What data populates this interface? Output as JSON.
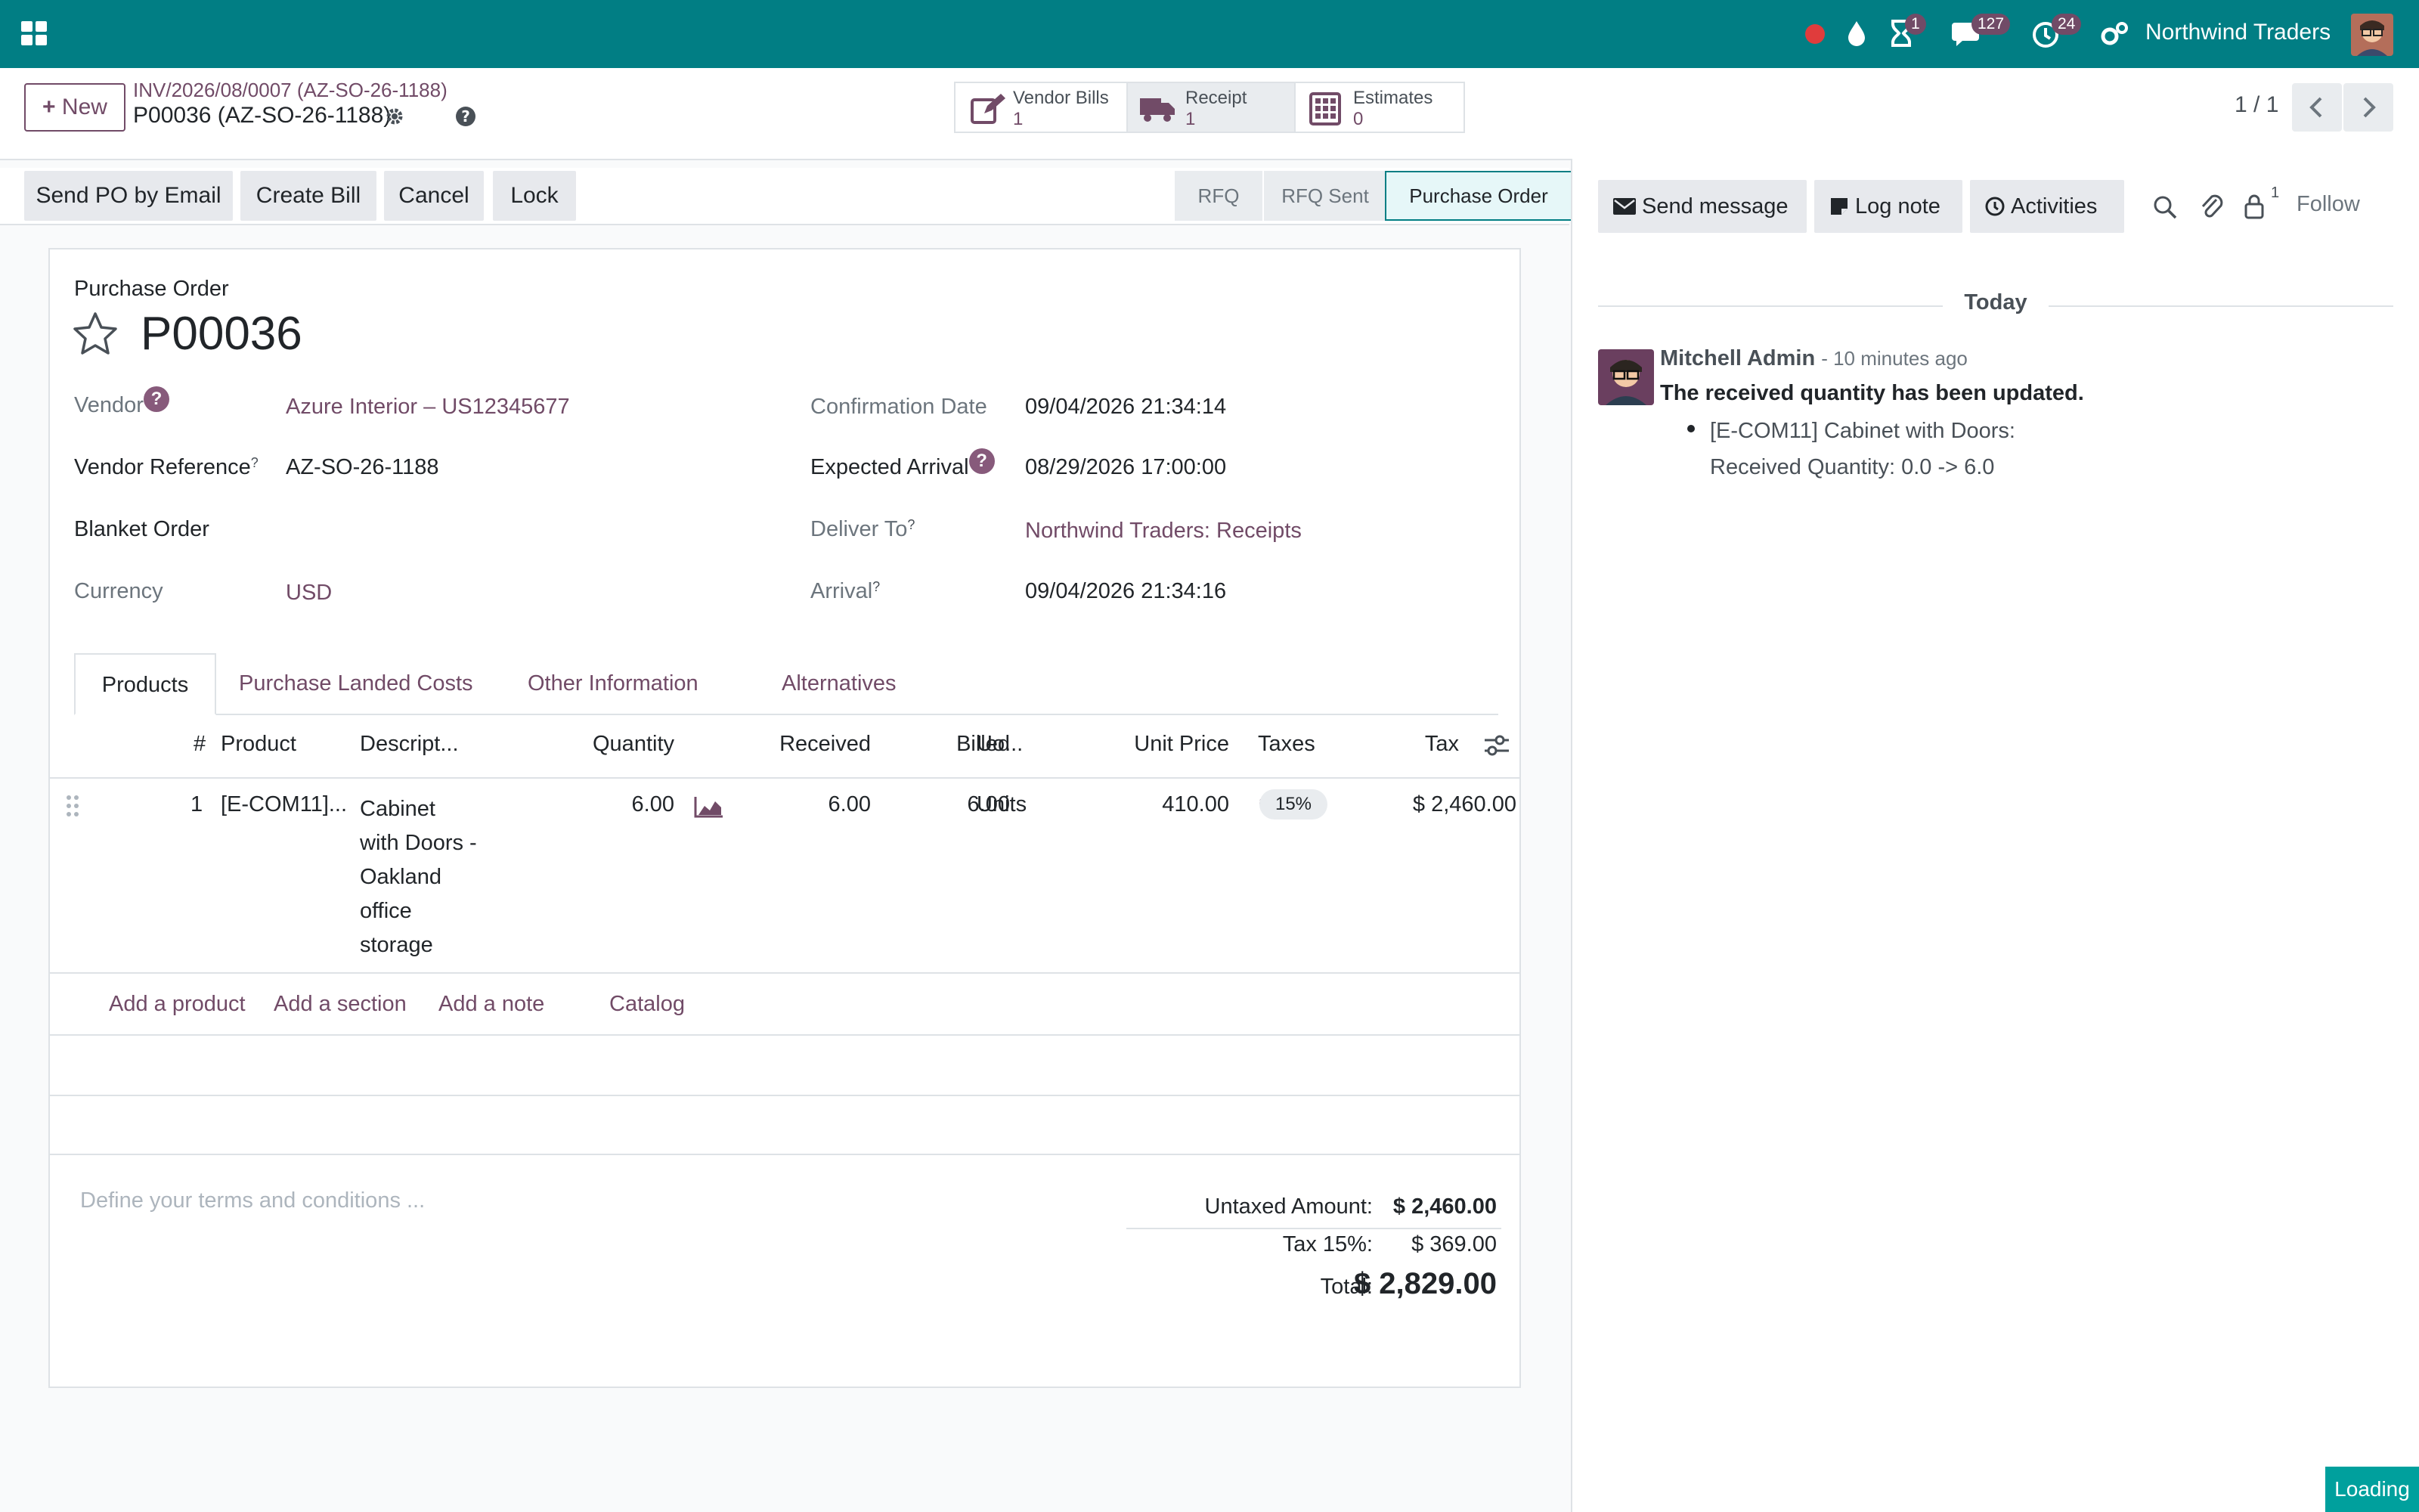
{
  "topbar": {
    "user_company": "Northwind Traders",
    "badges": {
      "activities": "1",
      "messages": "127",
      "timers": "24"
    },
    "colors": {
      "bar": "#017e84",
      "badge": "#714b67",
      "record": "#e03c3c"
    }
  },
  "control": {
    "new_label": "New",
    "breadcrumb_parent": "INV/2026/08/0007 (AZ-SO-26-1188)",
    "breadcrumb_current": "P00036 (AZ-SO-26-1188)",
    "smart_buttons": [
      {
        "label": "Vendor Bills",
        "count": "1"
      },
      {
        "label": "Receipt",
        "count": "1"
      },
      {
        "label": "Estimates",
        "count": "0"
      }
    ],
    "pager": "1 / 1"
  },
  "actions": {
    "send_po": "Send PO by Email",
    "create_bill": "Create Bill",
    "cancel": "Cancel",
    "lock": "Lock",
    "stages": [
      "RFQ",
      "RFQ Sent",
      "Purchase Order"
    ]
  },
  "form": {
    "doc_type": "Purchase Order",
    "name": "P00036",
    "vendor_label": "Vendor",
    "vendor_value": "Azure Interior – US12345677",
    "vendor_ref_label": "Vendor Reference",
    "vendor_ref_value": "AZ-SO-26-1188",
    "blanket_label": "Blanket Order",
    "currency_label": "Currency",
    "currency_value": "USD",
    "confirm_label": "Confirmation Date",
    "confirm_value": "09/04/2026 21:34:14",
    "expected_label": "Expected Arrival",
    "expected_value": "08/29/2026 17:00:00",
    "deliver_label": "Deliver To",
    "deliver_value": "Northwind Traders: Receipts",
    "arrival_label": "Arrival",
    "arrival_value": "09/04/2026 21:34:16",
    "sup_mark": "?",
    "help_mark": "?"
  },
  "tabs": [
    "Products",
    "Purchase Landed Costs",
    "Other Information",
    "Alternatives"
  ],
  "lines": {
    "headers": {
      "num": "#",
      "product": "Product",
      "desc": "Descript...",
      "qty": "Quantity",
      "received": "Received",
      "billed": "Billed",
      "uom": "Uo...",
      "price": "Unit Price",
      "taxes": "Taxes",
      "tax": "Tax"
    },
    "row": {
      "num": "1",
      "product": "[E-COM11]...",
      "desc": [
        "Cabinet",
        "with Doors -",
        "Oakland",
        "office",
        "storage"
      ],
      "qty": "6.00",
      "received": "6.00",
      "billed": "6.00",
      "uom": "Units",
      "price": "410.00",
      "tax_badge": "15%",
      "subtotal": "$ 2,460.00"
    },
    "add_product": "Add a product",
    "add_section": "Add a section",
    "add_note": "Add a note",
    "catalog": "Catalog"
  },
  "totals": {
    "terms_placeholder": "Define your terms and conditions ...",
    "untaxed_label": "Untaxed Amount:",
    "untaxed_value": "$ 2,460.00",
    "tax_label": "Tax 15%:",
    "tax_value": "$ 369.00",
    "total_label": "Total:",
    "total_value": "$ 2,829.00"
  },
  "chatter": {
    "send_message": "Send message",
    "log_note": "Log note",
    "activities": "Activities",
    "followers_count": "1",
    "follow": "Follow",
    "date_sep": "Today",
    "author": "Mitchell Admin",
    "time": "- 10 minutes ago",
    "message": "The received quantity has been updated.",
    "bullet_line1": "[E-COM11] Cabinet with Doors:",
    "bullet_line2": "Received Quantity: 0.0 -> 6.0"
  },
  "loading": "Loading"
}
